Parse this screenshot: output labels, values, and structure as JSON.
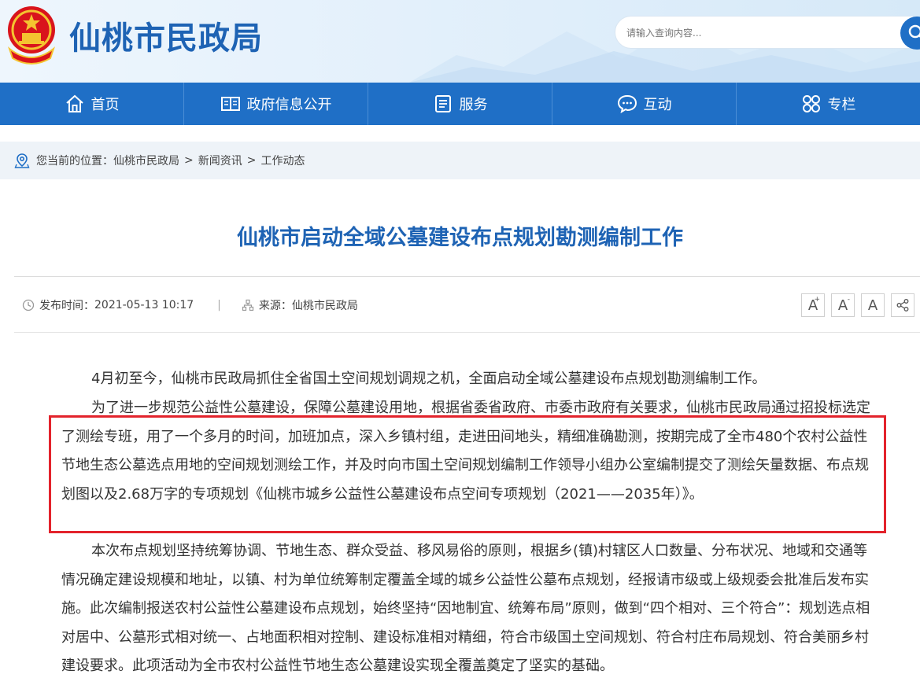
{
  "header": {
    "site_title": "仙桃市民政局",
    "search_placeholder": "请输入查询内容..."
  },
  "nav": {
    "items": [
      {
        "label": "首页",
        "icon": "home-icon"
      },
      {
        "label": "政府信息公开",
        "icon": "book-icon"
      },
      {
        "label": "服务",
        "icon": "document-icon"
      },
      {
        "label": "互动",
        "icon": "chat-icon"
      },
      {
        "label": "专栏",
        "icon": "grid-icon"
      }
    ]
  },
  "breadcrumb": {
    "prefix": "您当前的位置：",
    "items": [
      "仙桃市民政局",
      "新闻资讯",
      "工作动态"
    ],
    "separator": ">"
  },
  "article": {
    "title": "仙桃市启动全域公墓建设布点规划勘测编制工作",
    "publish_label": "发布时间：",
    "publish_time": "2021-05-13 10:17",
    "divider": "|",
    "source_label": "来源：",
    "source": "仙桃市民政局",
    "tools": [
      "A",
      "A",
      "A"
    ],
    "tool_marks": [
      "+",
      "-"
    ],
    "paragraphs": [
      "4月初至今，仙桃市民政局抓住全省国土空间规划调规之机，全面启动全域公墓建设布点规划勘测编制工作。",
      "为了进一步规范公益性公墓建设，保障公墓建设用地，根据省委省政府、市委市政府有关要求，仙桃市民政局通过招投标选定了测绘专班，用了一个多月的时间，加班加点，深入乡镇村组，走进田间地头，精细准确勘测，按期完成了全市480个农村公益性节地生态公墓选点用地的空间规划测绘工作，并及时向市国土空间规划编制工作领导小组办公室编制提交了测绘矢量数据、布点规划图以及2.68万字的专项规划《仙桃市城乡公益性公墓建设布点空间专项规划（2021——2035年）》。",
      "本次布点规划坚持统筹协调、节地生态、群众受益、移风易俗的原则，根据乡(镇)村辖区人口数量、分布状况、地域和交通等情况确定建设规模和地址，以镇、村为单位统筹制定覆盖全域的城乡公益性公墓布点规划，经报请市级或上级规委会批准后发布实施。此次编制报送农村公益性公墓建设布点规划，始终坚持“因地制宜、统筹布局”原则，做到“四个相对、三个符合”：规划选点相对居中、公墓形式相对统一、占地面积相对控制、建设标准相对精细，符合市级国土空间规划、符合村庄布局规划、符合美丽乡村建设要求。此项活动为全市农村公益性节地生态公墓建设实现全覆盖奠定了坚实的基础。"
    ]
  },
  "colors": {
    "brand_blue": "#1f6fc6",
    "title_blue": "#1e63b4",
    "highlight_red": "#e3232c"
  }
}
